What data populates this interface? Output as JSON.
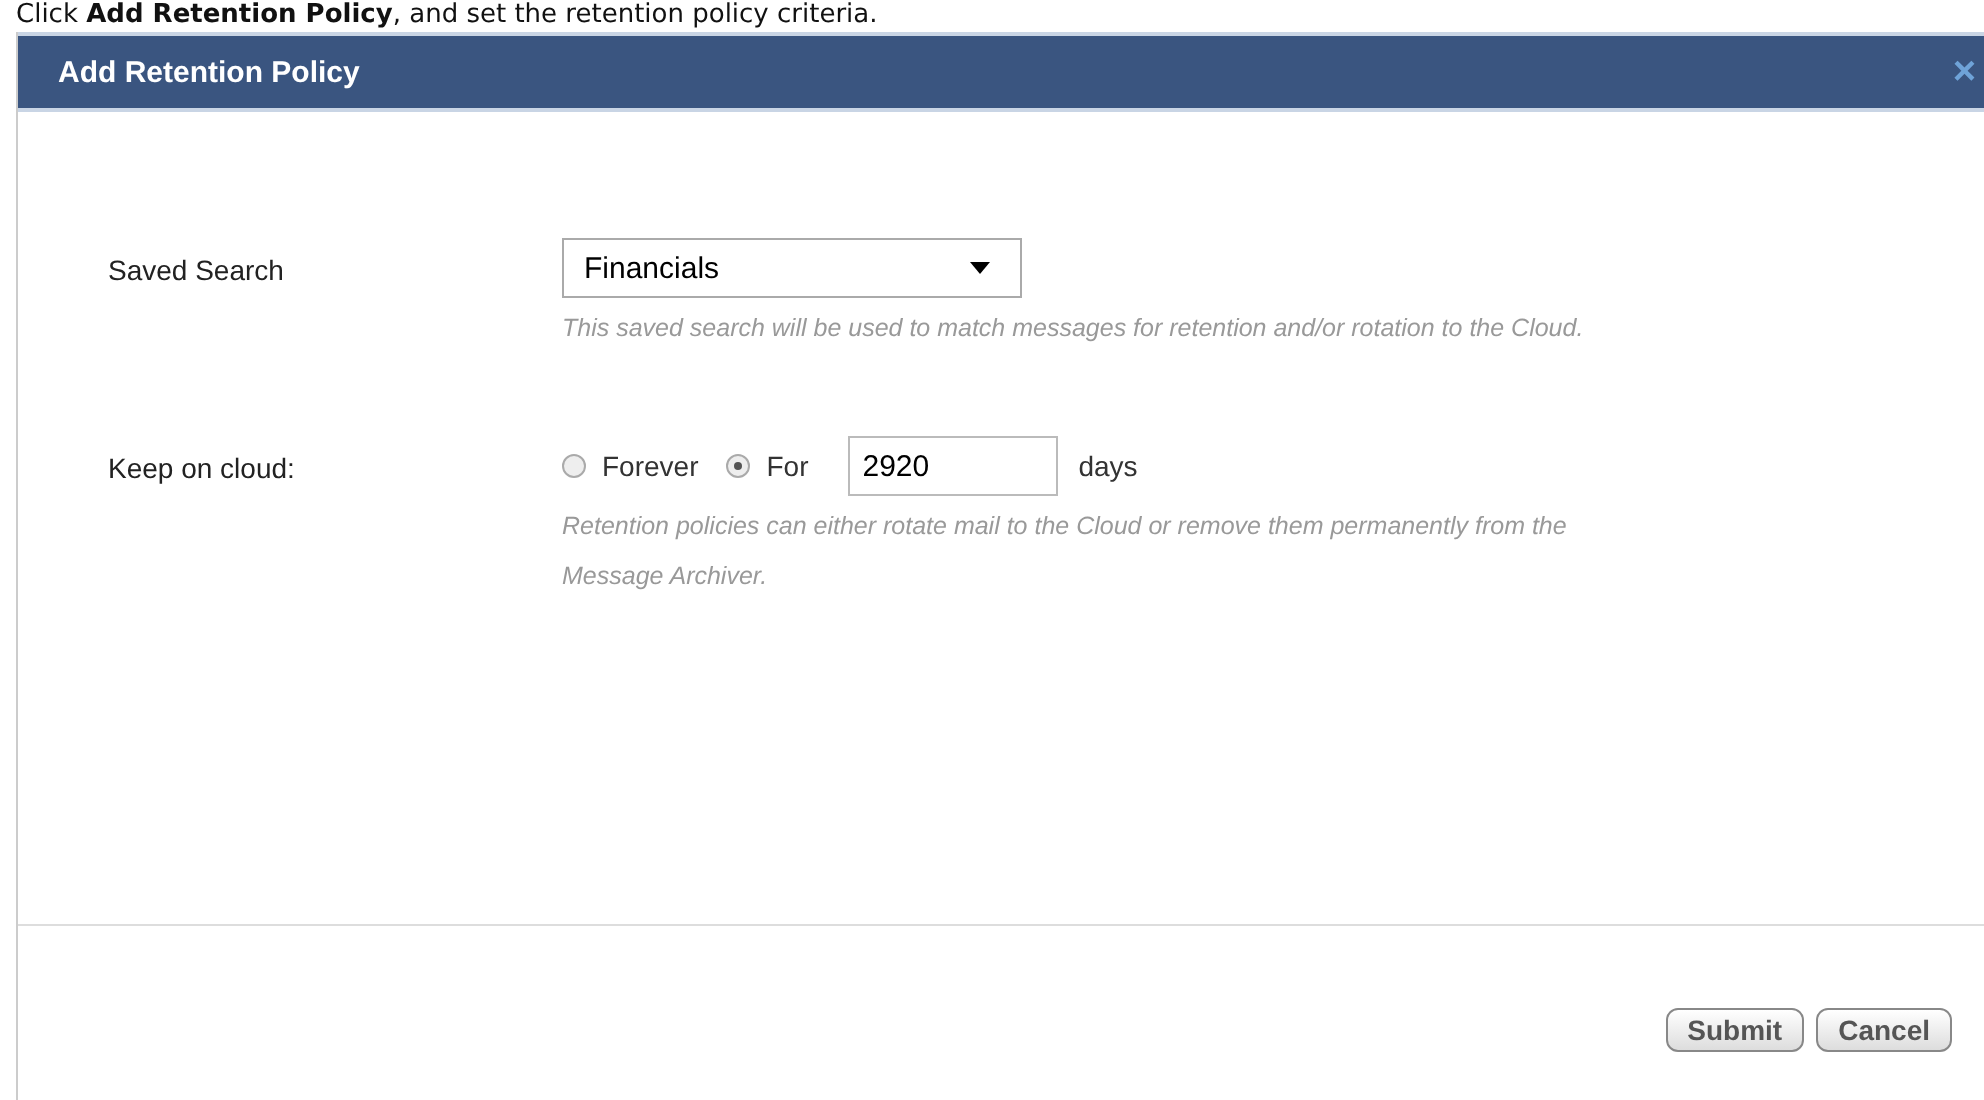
{
  "instruction": "Click **Add Retention Policy**, and set the retention policy criteria.",
  "dialog": {
    "title": "Add Retention Policy",
    "close": "×",
    "fields": [
      {
        "kind": "select",
        "label": "Saved Search",
        "value": "Financials",
        "hint": "This saved search will be used to match messages for retention and/or rotation to the Cloud."
      },
      {
        "kind": "radios",
        "label": "Keep on cloud:",
        "options": [
          {
            "label": "Forever",
            "selected": false
          },
          {
            "label": "For",
            "selected": true
          }
        ],
        "value": "2920",
        "unit": "days",
        "hint": "Retention policies can either rotate mail to the Cloud or remove them permanently from the Message Archiver."
      }
    ],
    "buttons": [
      "Submit",
      "Cancel"
    ]
  }
}
